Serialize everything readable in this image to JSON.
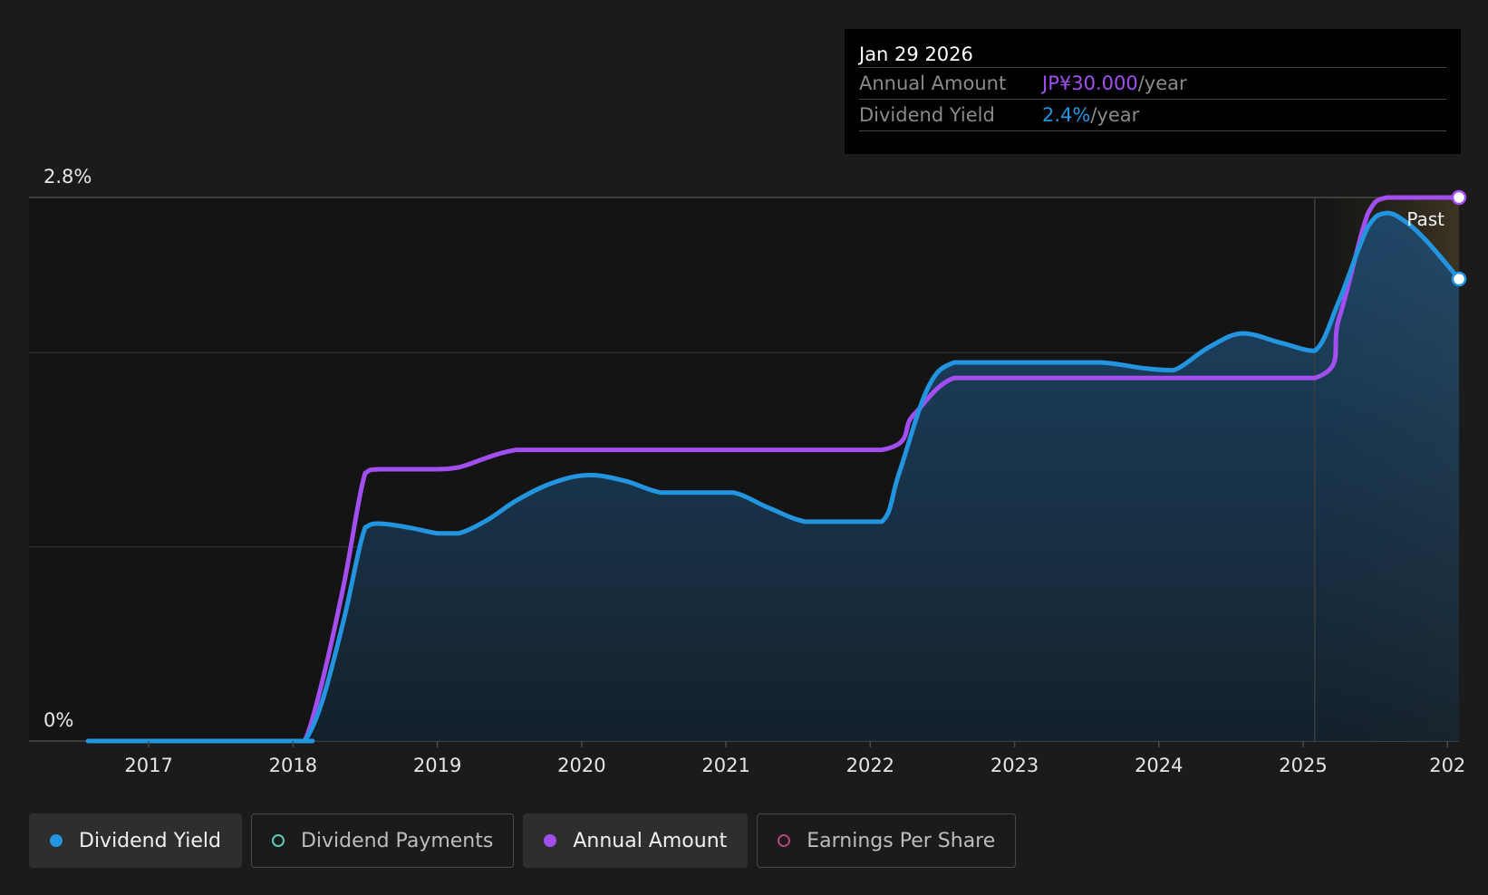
{
  "colors": {
    "yield": "#2394df",
    "annual": "#a34ef0",
    "payments": "#5fc9b9",
    "eps": "#b3447b",
    "background": "#1b1b1b",
    "plot_bg": "#141414"
  },
  "tooltip": {
    "date": "Jan 29 2026",
    "rows": [
      {
        "label": "Annual Amount",
        "value": "JP¥30.000",
        "unit": "/year"
      },
      {
        "label": "Dividend Yield",
        "value": "2.4%",
        "unit": "/year"
      }
    ]
  },
  "legend": [
    {
      "label": "Dividend Yield",
      "active": true,
      "marker": "filled",
      "color_key": "yield"
    },
    {
      "label": "Dividend Payments",
      "active": false,
      "marker": "hollow",
      "color_key": "payments"
    },
    {
      "label": "Annual Amount",
      "active": true,
      "marker": "filled",
      "color_key": "annual"
    },
    {
      "label": "Earnings Per Share",
      "active": false,
      "marker": "hollow",
      "color_key": "eps"
    }
  ],
  "chart_data": {
    "type": "area",
    "x_ticks": [
      "2017",
      "2018",
      "2019",
      "2020",
      "2021",
      "2022",
      "2023",
      "2024",
      "2025",
      "202"
    ],
    "y_tick_labels": [
      "2.8%",
      "0%"
    ],
    "ylim": [
      0,
      2.8
    ],
    "xlim": [
      2016.17,
      2026.08
    ],
    "grid": true,
    "past_label": "Past",
    "past_start": 2025.08,
    "series": [
      {
        "name": "Dividend Yield",
        "color_key": "yield",
        "fill": true,
        "x": [
          2016.58,
          2018.0,
          2018.08,
          2018.2,
          2018.35,
          2018.5,
          2018.6,
          2018.8,
          2019.0,
          2019.15,
          2019.35,
          2019.55,
          2019.8,
          2020.05,
          2020.3,
          2020.55,
          2020.8,
          2021.05,
          2021.3,
          2021.55,
          2021.8,
          2022.08,
          2022.2,
          2022.4,
          2022.58,
          2022.8,
          2023.2,
          2023.6,
          2023.9,
          2024.1,
          2024.35,
          2024.58,
          2024.85,
          2025.08,
          2025.25,
          2025.45,
          2025.58,
          2025.7,
          2025.85,
          2026.08
        ],
        "y": [
          0.0,
          0.0,
          0.0,
          0.2,
          0.62,
          1.1,
          1.12,
          1.1,
          1.07,
          1.07,
          1.14,
          1.24,
          1.33,
          1.37,
          1.34,
          1.28,
          1.28,
          1.28,
          1.2,
          1.13,
          1.13,
          1.13,
          1.38,
          1.82,
          1.95,
          1.95,
          1.95,
          1.95,
          1.92,
          1.91,
          2.03,
          2.1,
          2.05,
          2.01,
          2.27,
          2.65,
          2.72,
          2.68,
          2.58,
          2.38
        ]
      },
      {
        "name": "Annual Amount",
        "color_key": "annual",
        "fill": false,
        "x": [
          2016.58,
          2018.0,
          2018.08,
          2018.2,
          2018.35,
          2018.5,
          2018.6,
          2019.0,
          2019.15,
          2019.55,
          2020.0,
          2021.0,
          2022.08,
          2022.3,
          2022.58,
          2023.0,
          2024.0,
          2025.08,
          2025.25,
          2025.45,
          2025.58,
          2025.8,
          2026.08
        ],
        "y": [
          0.0,
          0.0,
          0.0,
          0.3,
          0.8,
          1.38,
          1.4,
          1.4,
          1.41,
          1.5,
          1.5,
          1.5,
          1.5,
          1.68,
          1.87,
          1.87,
          1.87,
          1.87,
          2.18,
          2.72,
          2.8,
          2.8,
          2.8
        ]
      }
    ]
  }
}
